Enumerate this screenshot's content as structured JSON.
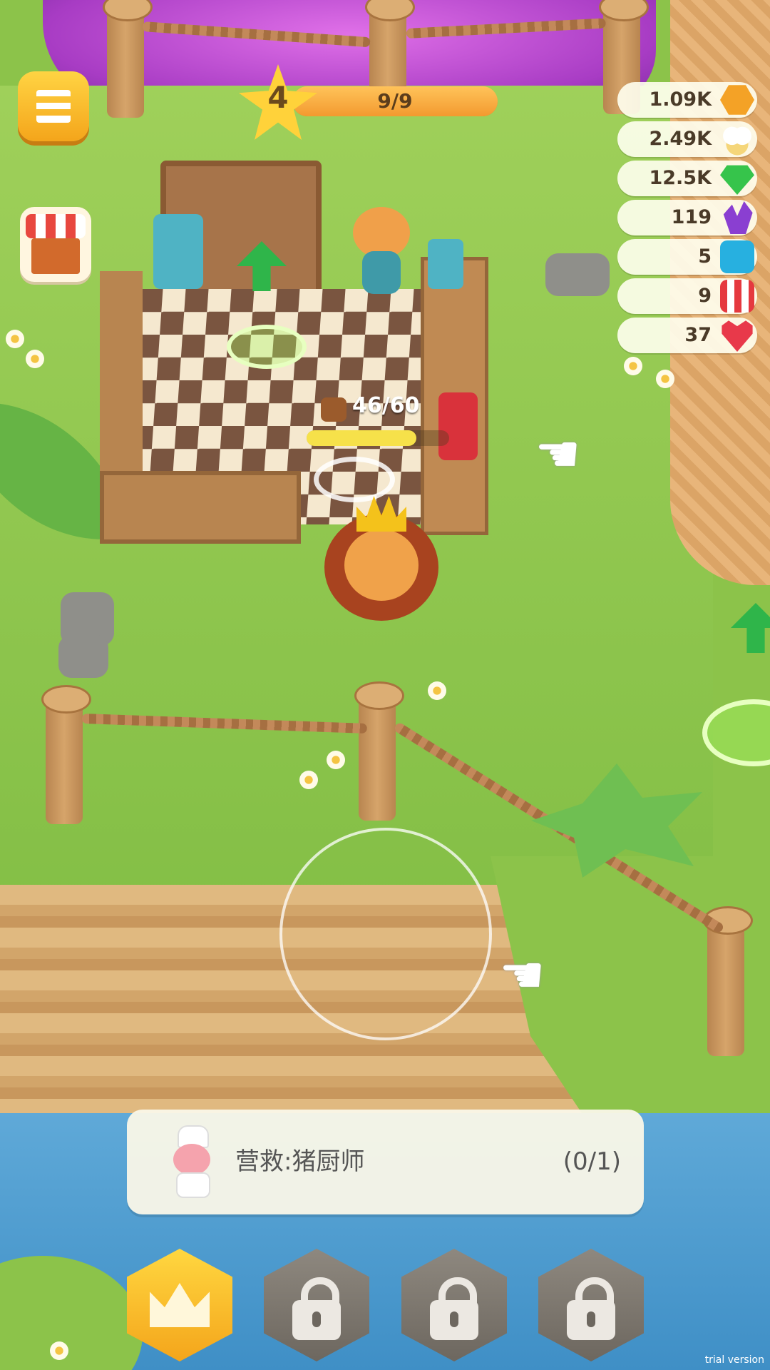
{
  "hud": {
    "level": {
      "number": "4",
      "progress_text": "9/9",
      "progress_fraction": 1.0
    },
    "resources": [
      {
        "value": "1.09K",
        "icon": "hex-coin-icon",
        "color": "#f4a226"
      },
      {
        "value": "2.49K",
        "icon": "popcorn-icon",
        "color": "#f5d67a"
      },
      {
        "value": "12.5K",
        "icon": "green-gem-icon",
        "color": "#36c44b"
      },
      {
        "value": "119",
        "icon": "purple-crystal-icon",
        "color": "#8a3fd1"
      },
      {
        "value": "5",
        "icon": "video-ticket-icon",
        "color": "#27b0e0"
      },
      {
        "value": "9",
        "icon": "striped-ticket-icon",
        "color": "#e5393f"
      },
      {
        "value": "37",
        "icon": "heart-icon",
        "color": "#e8394a"
      }
    ],
    "menu_icon": "menu-icon",
    "shop_icon": "shop-icon"
  },
  "capacity": {
    "text": "46/60",
    "fraction": 0.77,
    "icon": "bag-icon"
  },
  "mission": {
    "text": "营救:猪厨师",
    "progress": "(0/1)",
    "avatar": "pig-chef-icon"
  },
  "bottom_bar": [
    {
      "icon": "crown-icon",
      "state": "active"
    },
    {
      "icon": "lock-icon",
      "state": "locked"
    },
    {
      "icon": "lock-icon",
      "state": "locked"
    },
    {
      "icon": "lock-icon",
      "state": "locked"
    }
  ],
  "trial_label": "trial version",
  "colors": {
    "grass": "#8cc34a",
    "accent": "#f4a51b",
    "water": "#4f9dd0"
  }
}
